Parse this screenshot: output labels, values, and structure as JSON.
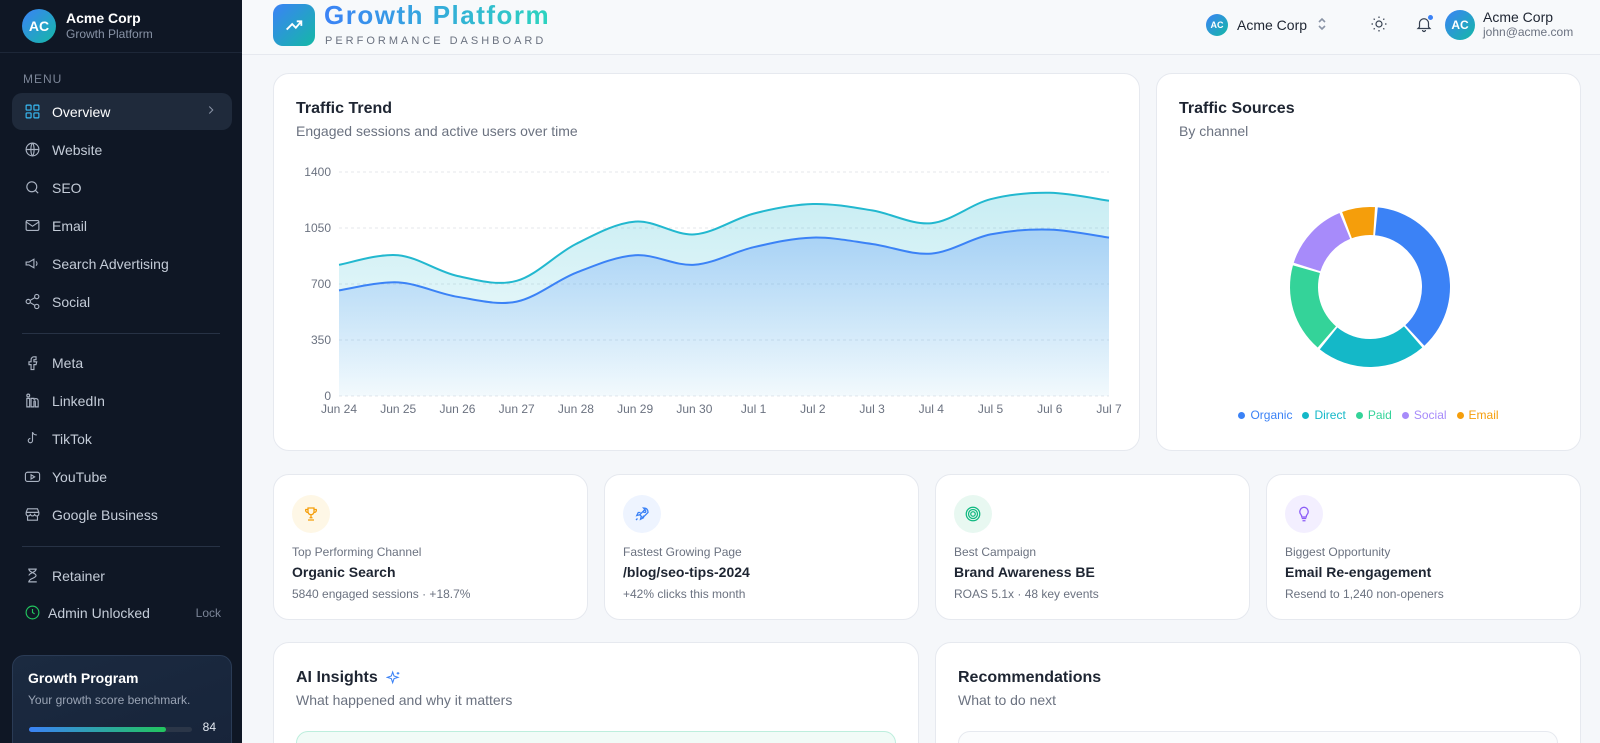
{
  "sidebar": {
    "brand": {
      "initials": "AC",
      "name": "Acme Corp",
      "subtitle": "Growth Platform"
    },
    "menu_label": "MENU",
    "items": [
      {
        "label": "Overview",
        "icon": "grid-icon",
        "active": true
      },
      {
        "label": "Website",
        "icon": "globe-icon"
      },
      {
        "label": "SEO",
        "icon": "search-icon"
      },
      {
        "label": "Email",
        "icon": "mail-icon"
      },
      {
        "label": "Search Advertising",
        "icon": "megaphone-icon"
      },
      {
        "label": "Social",
        "icon": "share-icon"
      },
      {
        "label": "Meta",
        "icon": "facebook-icon"
      },
      {
        "label": "LinkedIn",
        "icon": "linkedin-icon"
      },
      {
        "label": "TikTok",
        "icon": "tiktok-icon"
      },
      {
        "label": "YouTube",
        "icon": "youtube-icon"
      },
      {
        "label": "Google Business",
        "icon": "store-icon"
      },
      {
        "label": "Retainer",
        "icon": "hourglass-icon"
      },
      {
        "label": "Admin Unlocked",
        "icon": "clock-icon"
      }
    ],
    "lock_label": "Lock",
    "growth_card": {
      "title": "Growth Program",
      "subtitle": "Your growth score benchmark.",
      "score": "84",
      "progress": 0.84
    }
  },
  "header": {
    "title": "Growth Platform",
    "subtitle": "PERFORMANCE DASHBOARD",
    "org": {
      "initials": "AC",
      "name": "Acme Corp"
    },
    "user": {
      "initials": "AC",
      "name": "Acme Corp",
      "email": "john@acme.com"
    },
    "icons": [
      "sun-icon",
      "bell-icon"
    ]
  },
  "traffic_trend": {
    "title": "Traffic Trend",
    "subtitle": "Engaged sessions and active users over time"
  },
  "traffic_sources": {
    "title": "Traffic Sources",
    "subtitle": "By channel"
  },
  "stats": [
    {
      "label": "Top Performing Channel",
      "value": "Organic Search",
      "meta": "5840 engaged sessions · +18.7%",
      "icon": "trophy-icon",
      "color": "#f59e0b",
      "bg": "#fef7e6"
    },
    {
      "label": "Fastest Growing Page",
      "value": "/blog/seo-tips-2024",
      "meta": "+42% clicks this month",
      "icon": "rocket-icon",
      "color": "#3b82f6",
      "bg": "#eef4ff"
    },
    {
      "label": "Best Campaign",
      "value": "Brand Awareness BE",
      "meta": "ROAS 5.1x · 48 key events",
      "icon": "target-icon",
      "color": "#10b981",
      "bg": "#e8f8f1"
    },
    {
      "label": "Biggest Opportunity",
      "value": "Email Re-engagement",
      "meta": "Resend to 1,240 non-openers",
      "icon": "lightbulb-icon",
      "color": "#8b5cf6",
      "bg": "#f3efff"
    }
  ],
  "ai_insights": {
    "title": "AI Insights",
    "subtitle": "What happened and why it matters"
  },
  "recommendations": {
    "title": "Recommendations",
    "subtitle": "What to do next"
  },
  "colors": {
    "accent": "#3b82f6",
    "teal": "#22b8cf",
    "sidebar_bg": "#0f1725"
  },
  "chart_data": [
    {
      "type": "area",
      "categories": [
        "Jun 24",
        "Jun 25",
        "Jun 26",
        "Jun 27",
        "Jun 28",
        "Jun 29",
        "Jun 30",
        "Jul 1",
        "Jul 2",
        "Jul 3",
        "Jul 4",
        "Jul 5",
        "Jul 6",
        "Jul 7"
      ],
      "series": [
        {
          "values": [
            820,
            880,
            750,
            720,
            950,
            1090,
            1010,
            1140,
            1200,
            1160,
            1080,
            1230,
            1270,
            1220
          ],
          "color": "#22b8cf"
        },
        {
          "values": [
            660,
            710,
            620,
            590,
            770,
            880,
            820,
            930,
            990,
            950,
            890,
            1010,
            1040,
            990
          ],
          "color": "#3b82f6"
        }
      ],
      "ylim": [
        0,
        1400
      ],
      "yticks": [
        0,
        350,
        700,
        1050,
        1400
      ],
      "grid": true
    },
    {
      "type": "pie",
      "categories": [
        "Organic",
        "Direct",
        "Paid",
        "Social",
        "Email"
      ],
      "values": [
        36,
        22,
        18,
        14,
        7
      ],
      "colors": [
        "#3b82f6",
        "#14b8c8",
        "#34d399",
        "#a78bfa",
        "#f59e0b"
      ],
      "legend": "bottom"
    }
  ]
}
